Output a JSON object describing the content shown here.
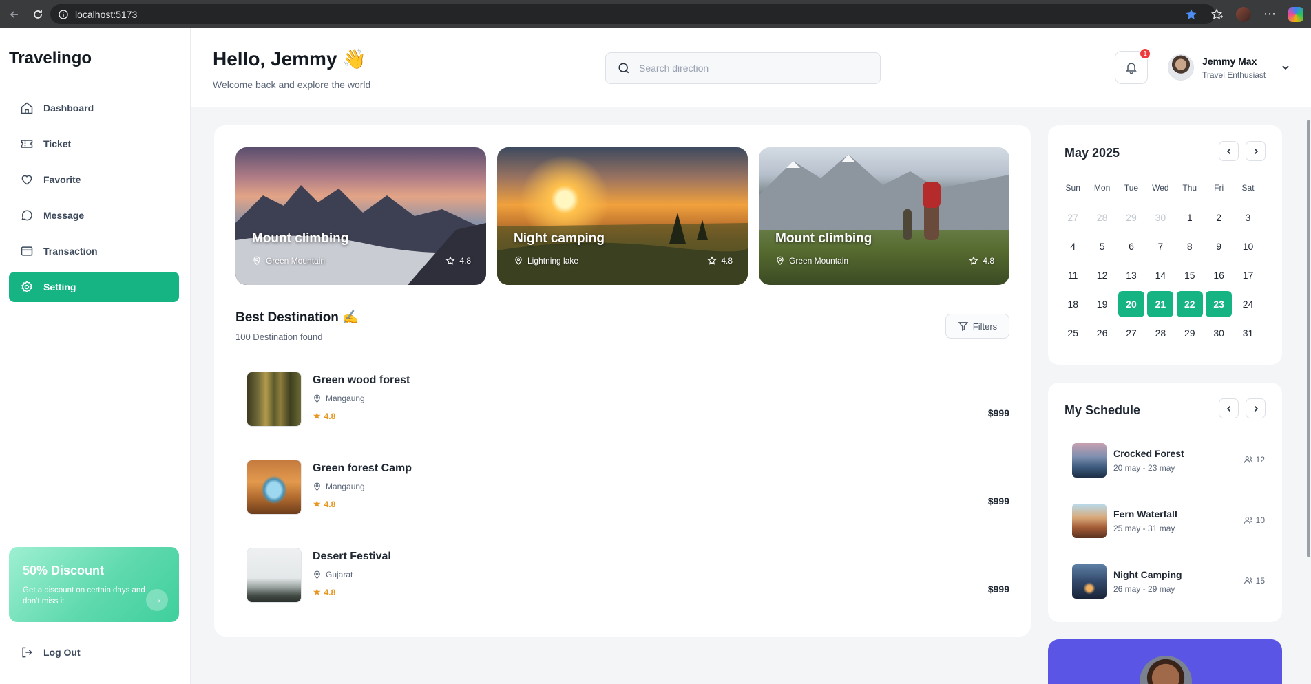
{
  "browser": {
    "url": "localhost:5173"
  },
  "sidebar": {
    "brand": "Travelingo",
    "items": [
      {
        "label": "Dashboard",
        "icon": "home-icon"
      },
      {
        "label": "Ticket",
        "icon": "ticket-icon"
      },
      {
        "label": "Favorite",
        "icon": "heart-icon"
      },
      {
        "label": "Message",
        "icon": "message-icon"
      },
      {
        "label": "Transaction",
        "icon": "card-icon"
      },
      {
        "label": "Setting",
        "icon": "gear-icon",
        "active": true
      }
    ],
    "discount": {
      "title": "50% Discount",
      "text": "Get a discount on certain days and don't miss it",
      "arrow": "→"
    },
    "logout": "Log Out"
  },
  "header": {
    "greeting": "Hello, Jemmy 👋",
    "subtitle": "Welcome back and explore the world",
    "search_placeholder": "Search direction",
    "notification_count": "1",
    "user_name": "Jemmy Max",
    "user_role": "Travel Enthusiast"
  },
  "featured": [
    {
      "title": "Mount climbing",
      "location": "Green Mountain",
      "rating": "4.8"
    },
    {
      "title": "Night camping",
      "location": "Lightning lake",
      "rating": "4.8"
    },
    {
      "title": "Mount climbing",
      "location": "Green Mountain",
      "rating": "4.8"
    }
  ],
  "best": {
    "title": "Best Destination ✍️",
    "count": "100 Destination found",
    "filters_label": "Filters",
    "items": [
      {
        "name": "Green wood forest",
        "location": "Mangaung",
        "rating": "4.8",
        "price": "$999"
      },
      {
        "name": "Green forest Camp",
        "location": "Mangaung",
        "rating": "4.8",
        "price": "$999"
      },
      {
        "name": "Desert Festival",
        "location": "Gujarat",
        "rating": "4.8",
        "price": "$999"
      }
    ]
  },
  "calendar": {
    "title": "May 2025",
    "weekdays": [
      "Sun",
      "Mon",
      "Tue",
      "Wed",
      "Thu",
      "Fri",
      "Sat"
    ],
    "days": [
      "27",
      "28",
      "29",
      "30",
      "1",
      "2",
      "3",
      "4",
      "5",
      "6",
      "7",
      "8",
      "9",
      "10",
      "11",
      "12",
      "13",
      "14",
      "15",
      "16",
      "17",
      "18",
      "19",
      "20",
      "21",
      "22",
      "23",
      "24",
      "25",
      "26",
      "27",
      "28",
      "29",
      "30",
      "31"
    ],
    "muted_days_leading": 4,
    "selected": [
      "20",
      "21",
      "22",
      "23"
    ]
  },
  "schedule": {
    "title": "My Schedule",
    "items": [
      {
        "name": "Crocked Forest",
        "dates": "20 may - 23 may",
        "people": "12"
      },
      {
        "name": "Fern Waterfall",
        "dates": "25 may - 31 may",
        "people": "10"
      },
      {
        "name": "Night Camping",
        "dates": "26 may - 29 may",
        "people": "15"
      }
    ]
  },
  "colors": {
    "accent": "#16b383",
    "promo": "#5b55e6",
    "rating": "#e8961f",
    "badge": "#ef3b3b"
  }
}
